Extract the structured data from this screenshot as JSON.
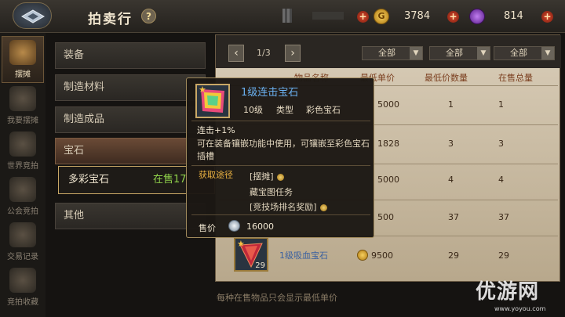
{
  "header": {
    "title": "拍卖行",
    "help_icon": "?",
    "gold": "3784",
    "gems": "814"
  },
  "nav": [
    {
      "label": "摆摊",
      "active": true
    },
    {
      "label": "我要摆摊"
    },
    {
      "label": "世界竞拍"
    },
    {
      "label": "公会竞拍"
    },
    {
      "label": "交易记录"
    },
    {
      "label": "竞拍收藏"
    }
  ],
  "categories": [
    "装备",
    "制造材料",
    "制造成品",
    "宝石",
    "其他"
  ],
  "subcategory": {
    "label": "多彩宝石",
    "status": "在售17"
  },
  "table": {
    "page": "1/3",
    "filters": [
      "全部",
      "全部",
      "全部"
    ],
    "headers": [
      "物品名称",
      "最低单价",
      "最低价数量",
      "在售总量"
    ],
    "rows": [
      {
        "price": "5000",
        "qty": "1",
        "total": "1"
      },
      {
        "price": "1828",
        "qty": "3",
        "total": "3"
      },
      {
        "price": "5000",
        "qty": "4",
        "total": "4"
      },
      {
        "price": "500",
        "qty": "37",
        "total": "37"
      },
      {
        "name": "1级吸血宝石",
        "count": "29",
        "price": "9500",
        "qty": "29",
        "total": "29"
      }
    ],
    "note": "每种在售物品只会显示最低单价"
  },
  "tooltip": {
    "name": "1级连击宝石",
    "level": "10级",
    "type_label": "类型",
    "type_value": "彩色宝石",
    "effect": "连击+1%",
    "description": "可在装备镶嵌功能中使用，可镶嵌至彩色宝石插槽",
    "source_label": "获取途径",
    "sources": [
      "[摆摊]",
      "藏宝图任务",
      "[竞技场排名奖励]"
    ],
    "sell_label": "售价",
    "sell_price": "16000"
  },
  "watermark": {
    "text": "优游网",
    "url": "www.yoyou.com"
  }
}
